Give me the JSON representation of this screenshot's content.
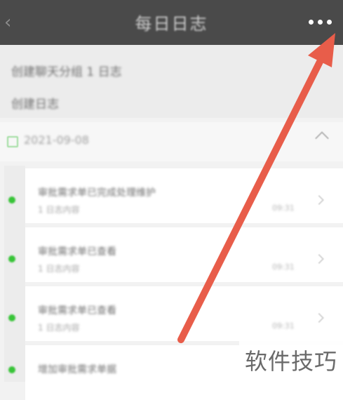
{
  "header": {
    "back_icon": "chevron-left-icon",
    "title": "每日日志",
    "more_icon": "more-horizontal-icon"
  },
  "info": {
    "line1": "创建聊天分组 1 日志",
    "line2": "创建日志"
  },
  "group": {
    "date": "2021-09-08",
    "collapse_icon": "chevron-up-icon"
  },
  "items": [
    {
      "title": "审批需求单已完成处理维护",
      "subtitle": "1 日志内容",
      "time": "09:31"
    },
    {
      "title": "审批需求单已查看",
      "subtitle": "1 日志内容",
      "time": "09:31"
    },
    {
      "title": "审批需求单已查看",
      "subtitle": "1 日志内容",
      "time": "09:31"
    },
    {
      "title": "增加审批需求单据",
      "subtitle": "",
      "time": ""
    }
  ],
  "annotation": {
    "arrow_color": "#e85d4a"
  },
  "watermark": {
    "text": "软件技巧"
  }
}
